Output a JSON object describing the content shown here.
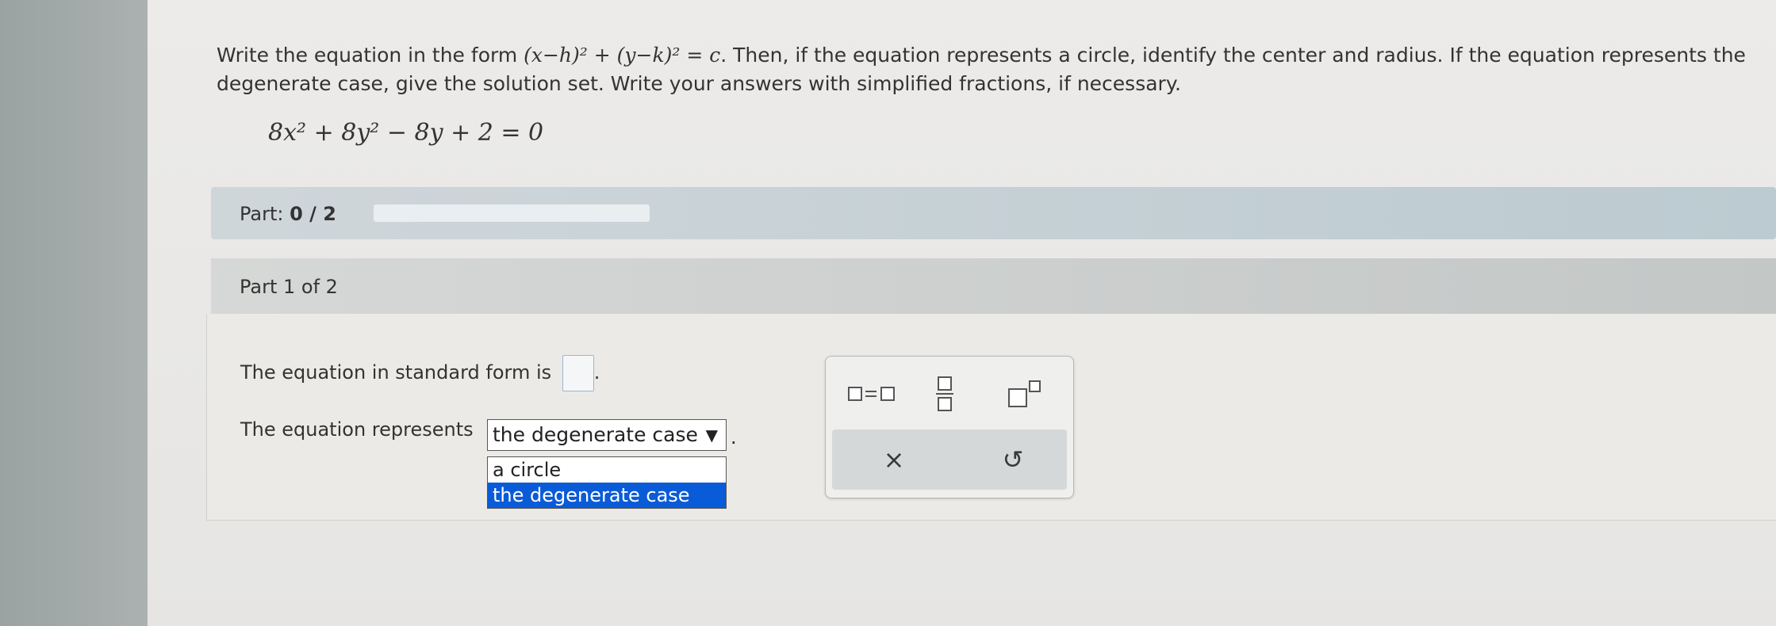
{
  "question": {
    "instruction_prefix": "Write the equation in the form ",
    "form_equation": "(x−h)² + (y−k)² = c",
    "instruction_suffix": ". Then, if the equation represents a circle, identify the center and radius. If the equation represents the degenerate case, give the solution set. Write your answers with simplified fractions, if necessary.",
    "equation": "8x² + 8y² − 8y + 2 = 0"
  },
  "progress": {
    "label": "Part:",
    "value": "0 / 2",
    "completed_fraction": 0
  },
  "part": {
    "header": "Part 1 of 2",
    "line1_prefix": "The equation in standard form is",
    "line1_suffix": ".",
    "line2_prefix": "The equation represents",
    "select_value": "the degenerate case",
    "select_arrow": "▼",
    "select_suffix": ".",
    "options": [
      "a circle",
      "the degenerate case"
    ],
    "selected_index": 1
  },
  "toolbox": {
    "equals_template_icon": "equals-template-icon",
    "fraction_icon": "fraction-icon",
    "exponent_icon": "exponent-icon",
    "clear_symbol": "×",
    "undo_symbol": "↺"
  },
  "colors": {
    "progress_accent": "#2d8fd5",
    "selected_option": "#0a5bd8"
  }
}
